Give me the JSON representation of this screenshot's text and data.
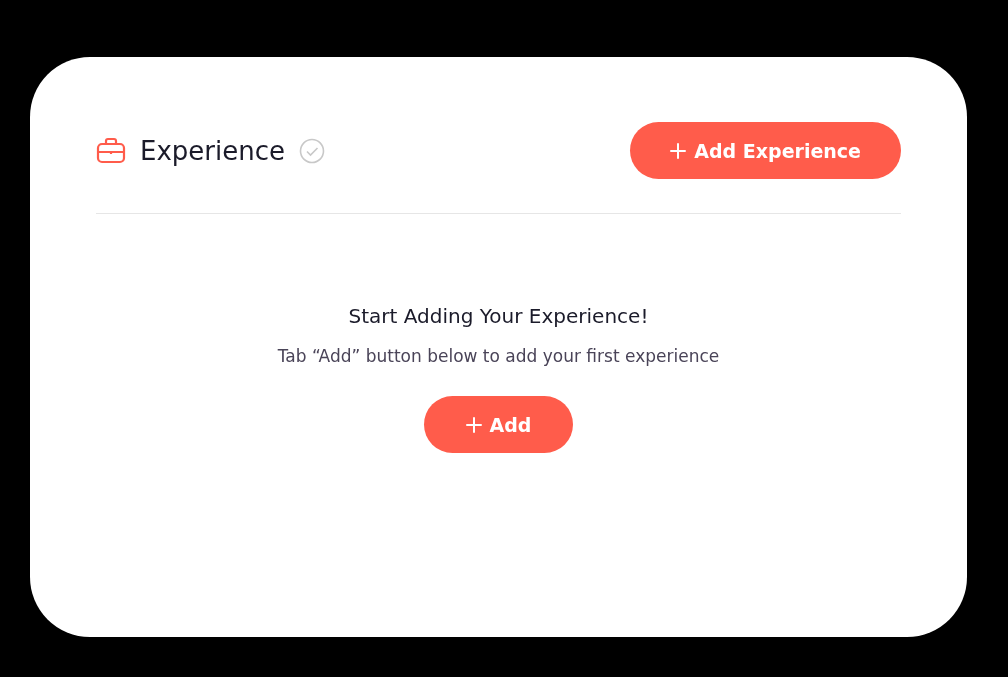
{
  "section": {
    "title": "Experience",
    "completed": false,
    "action_button": "Add Experience"
  },
  "empty_state": {
    "heading": "Start Adding Your Experience!",
    "message": "Tab “Add” button below to add your first experience",
    "button": "Add"
  }
}
